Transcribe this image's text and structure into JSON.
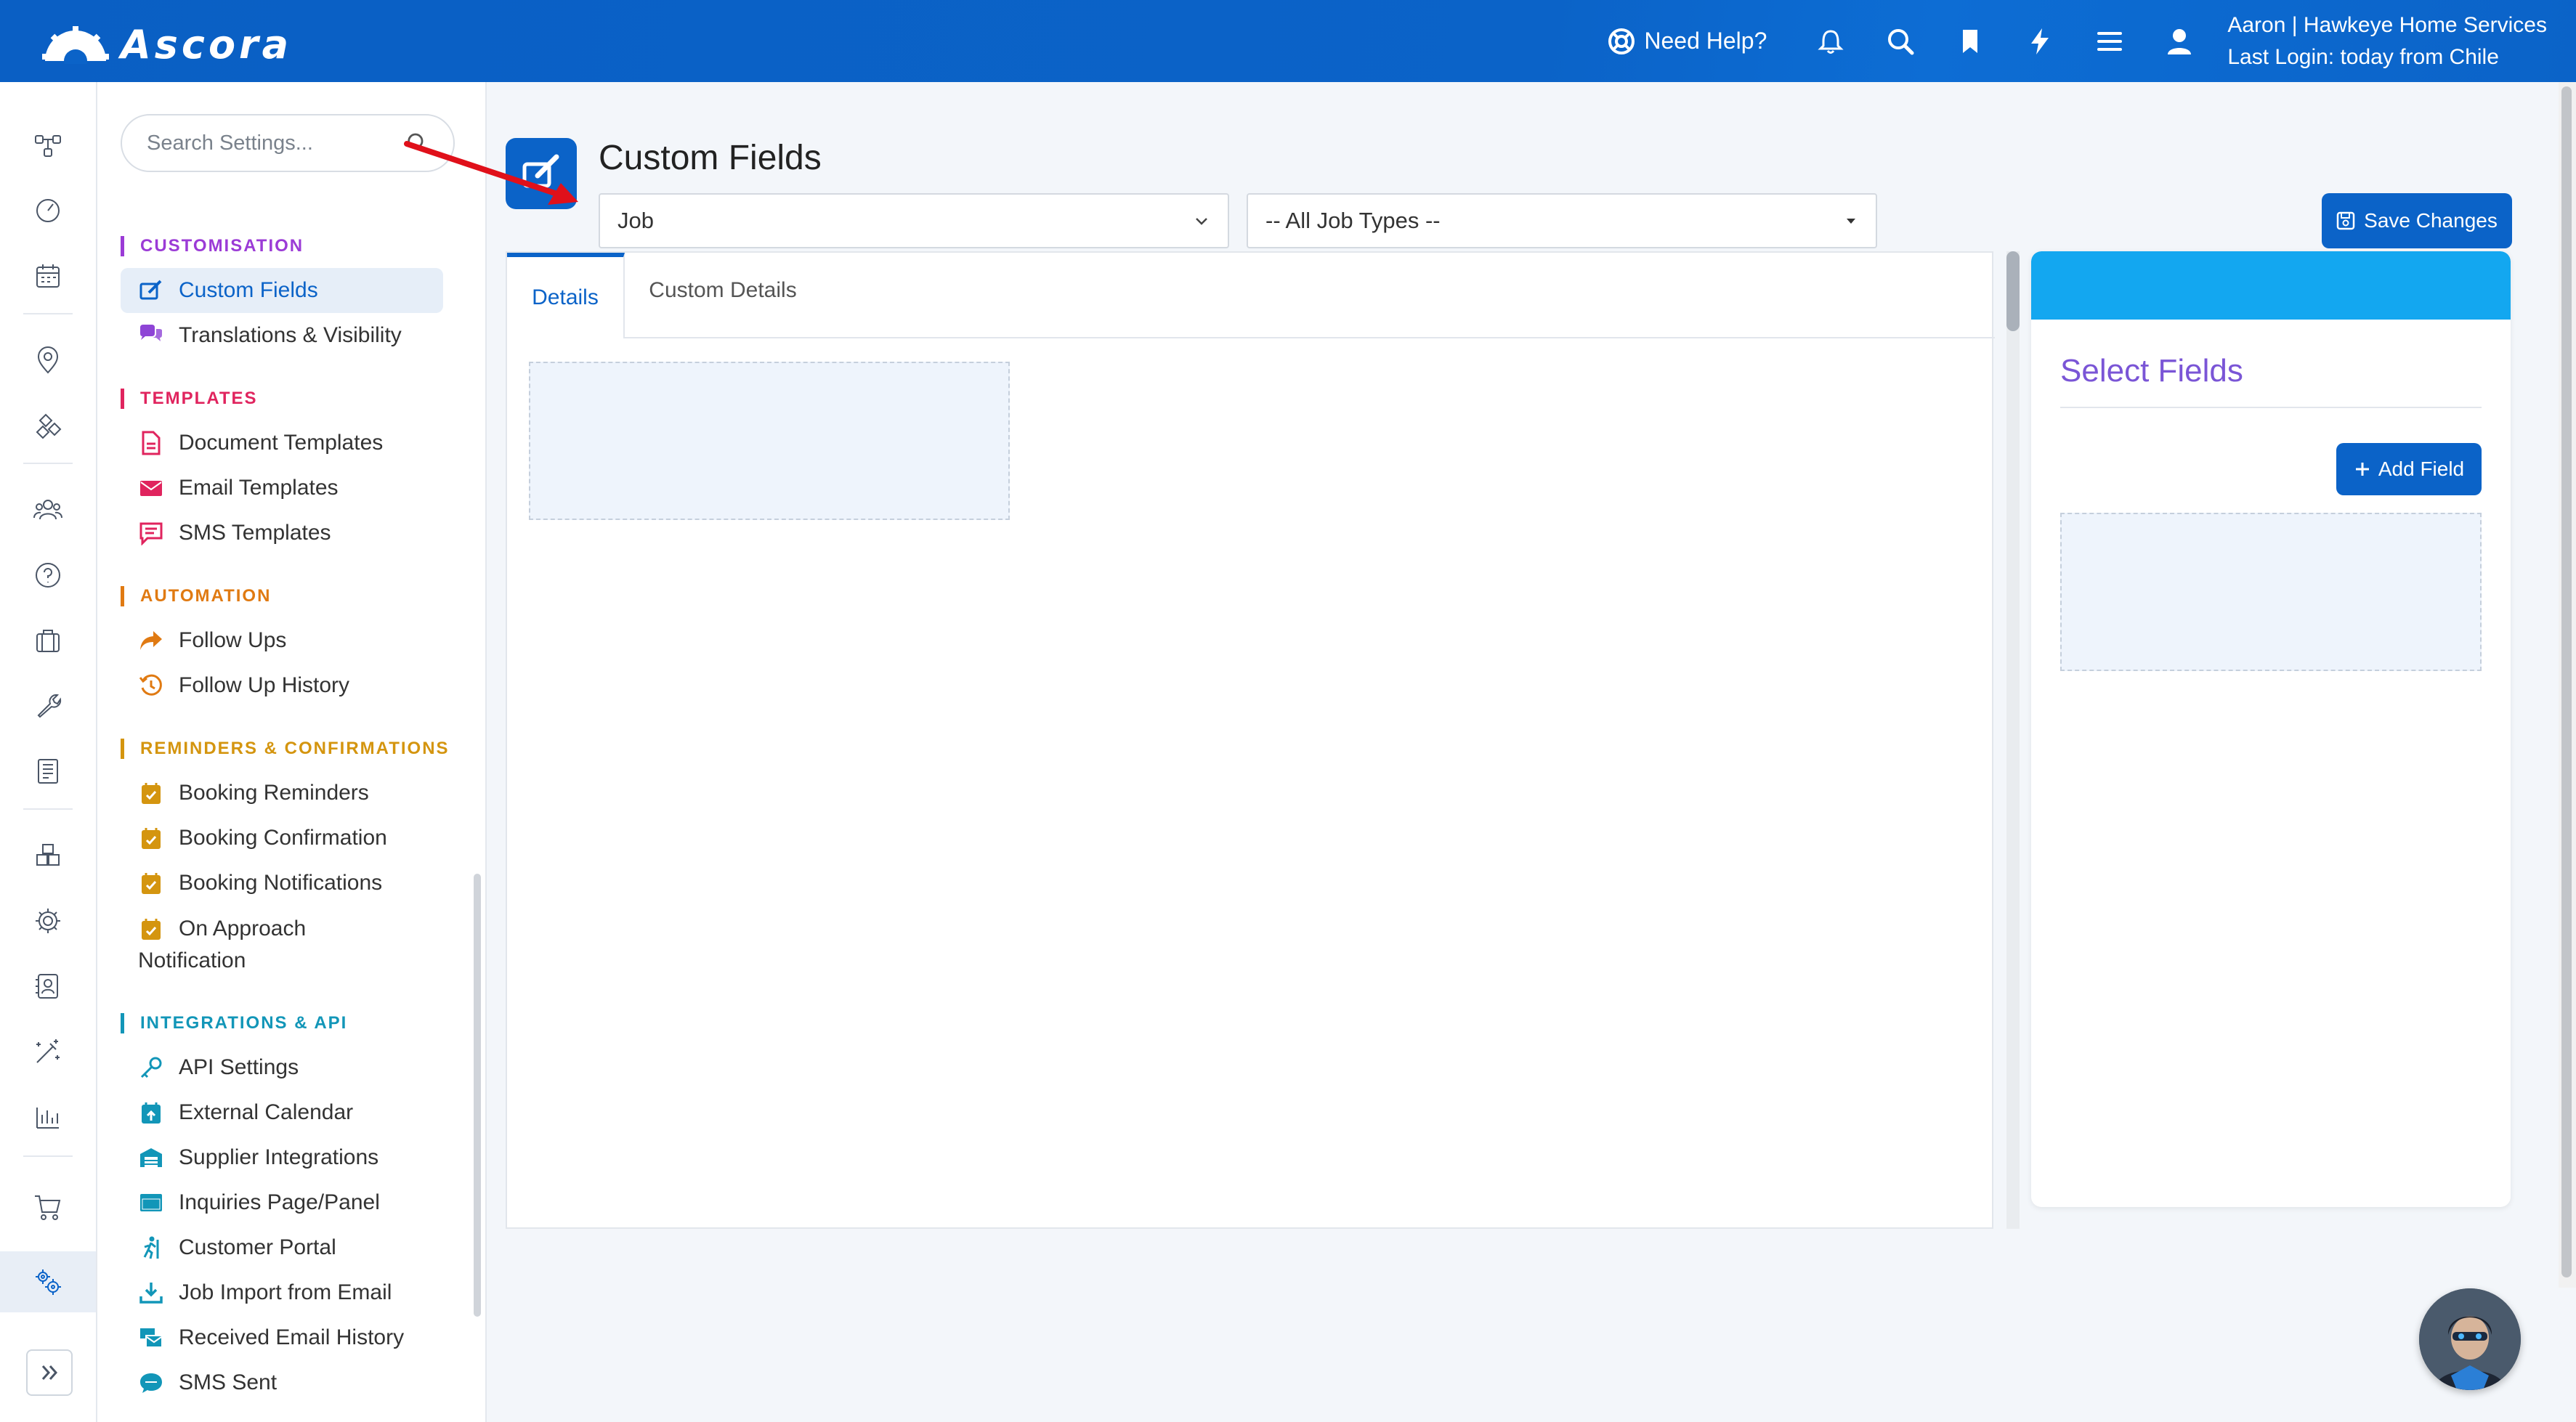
{
  "app": {
    "name": "Ascora"
  },
  "topbar": {
    "help_label": "Need Help?",
    "user_line1": "Aaron | Hawkeye Home Services",
    "user_line2": "Last Login: today from Chile",
    "icons": [
      "bell-icon",
      "search-icon",
      "bookmark-icon",
      "lightning-icon",
      "menu-icon",
      "user-icon"
    ]
  },
  "search": {
    "placeholder": "Search Settings..."
  },
  "sidebar": {
    "sections": [
      {
        "title": "CUSTOMISATION",
        "color": "#9b3bd6",
        "items": [
          {
            "label": "Custom Fields",
            "active": true
          },
          {
            "label": "Translations & Visibility"
          }
        ]
      },
      {
        "title": "TEMPLATES",
        "color": "#e0245e",
        "items": [
          {
            "label": "Document Templates"
          },
          {
            "label": "Email Templates"
          },
          {
            "label": "SMS Templates"
          }
        ]
      },
      {
        "title": "AUTOMATION",
        "color": "#e07a12",
        "items": [
          {
            "label": "Follow Ups"
          },
          {
            "label": "Follow Up History"
          }
        ]
      },
      {
        "title": "REMINDERS & CONFIRMATIONS",
        "color": "#d4950f",
        "items": [
          {
            "label": "Booking Reminders"
          },
          {
            "label": "Booking Confirmation"
          },
          {
            "label": "Booking Notifications"
          },
          {
            "label": "On Approach Notification"
          }
        ]
      },
      {
        "title": "INTEGRATIONS & API",
        "color": "#1296b8",
        "items": [
          {
            "label": "API Settings"
          },
          {
            "label": "External Calendar"
          },
          {
            "label": "Supplier Integrations"
          },
          {
            "label": "Inquiries Page/Panel"
          },
          {
            "label": "Customer Portal"
          },
          {
            "label": "Job Import from Email"
          },
          {
            "label": "Received Email History"
          },
          {
            "label": "SMS Sent"
          }
        ]
      }
    ]
  },
  "main": {
    "title": "Custom Fields",
    "entity_select": "Job",
    "job_type_select": "-- All Job Types --",
    "save_label": "Save Changes",
    "tabs": [
      {
        "label": "Details",
        "active": true
      },
      {
        "label": "Custom Details"
      }
    ]
  },
  "right_panel": {
    "title": "Select Fields",
    "add_label": "Add Field"
  },
  "colors": {
    "primary": "#0b63c8",
    "accent_header": "#13a7f0",
    "select_fields_title": "#7a55d6",
    "annotation_arrow": "#e0101a"
  }
}
